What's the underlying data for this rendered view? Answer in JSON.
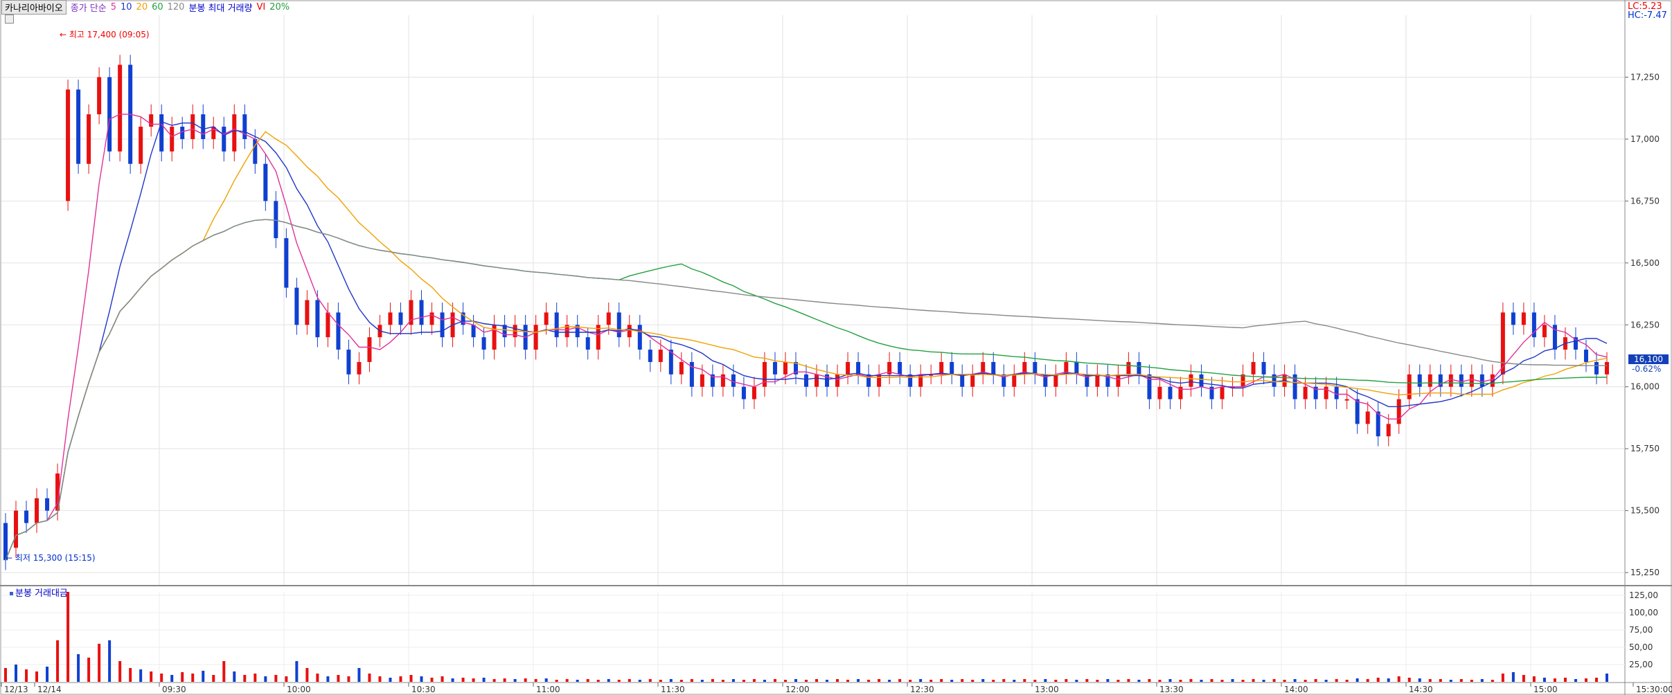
{
  "header": {
    "stock_name": "카나리아바이오",
    "ma_label": "종가 단순",
    "ma_periods": [
      "5",
      "10",
      "20",
      "60",
      "120"
    ],
    "volume_label": "분봉 최대 거래량",
    "vi_label": "VI",
    "vi_pct": "20%"
  },
  "annotations": {
    "high": "최고 17,400 (09:05)",
    "low": "최저 15,300 (15:15)"
  },
  "right": {
    "lc": "LC:5.23",
    "hc": "HC:-7.47",
    "current_price": "16,100",
    "current_change": "-0.62%"
  },
  "volume_panel": {
    "title": "분봉 거래대금"
  },
  "chart_data": [
    {
      "type": "candlestick",
      "title": "카나리아바이오",
      "y_ticks": [
        "17,250",
        "17,000",
        "16,750",
        "16,500",
        "16,250",
        "16,000",
        "15,750",
        "15,500",
        "15,250"
      ],
      "ylim": [
        15200,
        17500
      ],
      "x_ticks": [
        "12/13",
        "12/14",
        "09:30",
        "10:00",
        "10:30",
        "11:00",
        "11:30",
        "12:00",
        "12:30",
        "13:00",
        "13:30",
        "14:00",
        "14:30",
        "15:00",
        "15:30:00"
      ],
      "candles_open_close": [
        [
          15450,
          15300
        ],
        [
          15350,
          15500
        ],
        [
          15500,
          15450
        ],
        [
          15450,
          15550
        ],
        [
          15550,
          15500
        ],
        [
          15500,
          15650
        ],
        [
          16750,
          17200
        ],
        [
          17200,
          16900
        ],
        [
          16900,
          17100
        ],
        [
          17100,
          17250
        ],
        [
          17250,
          16950
        ],
        [
          16950,
          17300
        ],
        [
          17300,
          16900
        ],
        [
          16900,
          17050
        ],
        [
          17050,
          17100
        ],
        [
          17100,
          16950
        ],
        [
          16950,
          17050
        ],
        [
          17050,
          17000
        ],
        [
          17000,
          17100
        ],
        [
          17100,
          17000
        ],
        [
          17000,
          17050
        ],
        [
          17050,
          16950
        ],
        [
          16950,
          17100
        ],
        [
          17100,
          17000
        ],
        [
          17000,
          16900
        ],
        [
          16900,
          16750
        ],
        [
          16750,
          16600
        ],
        [
          16600,
          16400
        ],
        [
          16400,
          16250
        ],
        [
          16250,
          16350
        ],
        [
          16350,
          16200
        ],
        [
          16200,
          16300
        ],
        [
          16300,
          16150
        ],
        [
          16150,
          16050
        ],
        [
          16050,
          16100
        ],
        [
          16100,
          16200
        ],
        [
          16200,
          16250
        ],
        [
          16250,
          16300
        ],
        [
          16300,
          16250
        ],
        [
          16250,
          16350
        ],
        [
          16350,
          16250
        ],
        [
          16250,
          16300
        ],
        [
          16300,
          16200
        ],
        [
          16200,
          16300
        ],
        [
          16300,
          16250
        ],
        [
          16250,
          16200
        ],
        [
          16200,
          16150
        ],
        [
          16150,
          16250
        ],
        [
          16250,
          16200
        ],
        [
          16200,
          16250
        ],
        [
          16250,
          16150
        ],
        [
          16150,
          16250
        ],
        [
          16250,
          16300
        ],
        [
          16300,
          16200
        ],
        [
          16200,
          16250
        ],
        [
          16250,
          16200
        ],
        [
          16200,
          16150
        ],
        [
          16150,
          16250
        ],
        [
          16250,
          16300
        ],
        [
          16300,
          16200
        ],
        [
          16200,
          16250
        ],
        [
          16250,
          16150
        ],
        [
          16150,
          16100
        ],
        [
          16100,
          16150
        ],
        [
          16150,
          16050
        ],
        [
          16050,
          16100
        ],
        [
          16100,
          16000
        ],
        [
          16000,
          16050
        ],
        [
          16050,
          16000
        ],
        [
          16000,
          16050
        ],
        [
          16050,
          16000
        ],
        [
          16000,
          15950
        ],
        [
          15950,
          16000
        ],
        [
          16000,
          16100
        ],
        [
          16100,
          16050
        ],
        [
          16050,
          16100
        ],
        [
          16100,
          16050
        ],
        [
          16050,
          16000
        ],
        [
          16000,
          16050
        ],
        [
          16050,
          16000
        ],
        [
          16000,
          16050
        ],
        [
          16050,
          16100
        ],
        [
          16100,
          16050
        ],
        [
          16050,
          16000
        ],
        [
          16000,
          16050
        ],
        [
          16050,
          16100
        ],
        [
          16100,
          16050
        ],
        [
          16050,
          16000
        ],
        [
          16000,
          16050
        ],
        [
          16050,
          16050
        ],
        [
          16050,
          16100
        ],
        [
          16100,
          16050
        ],
        [
          16050,
          16000
        ],
        [
          16000,
          16050
        ],
        [
          16050,
          16100
        ],
        [
          16100,
          16050
        ],
        [
          16050,
          16000
        ],
        [
          16000,
          16050
        ],
        [
          16050,
          16100
        ],
        [
          16100,
          16050
        ],
        [
          16050,
          16000
        ],
        [
          16000,
          16050
        ],
        [
          16050,
          16100
        ],
        [
          16100,
          16050
        ],
        [
          16050,
          16000
        ],
        [
          16000,
          16050
        ],
        [
          16050,
          16000
        ],
        [
          16000,
          16050
        ],
        [
          16050,
          16100
        ],
        [
          16100,
          16050
        ],
        [
          16050,
          15950
        ],
        [
          15950,
          16000
        ],
        [
          16000,
          15950
        ],
        [
          15950,
          16000
        ],
        [
          16000,
          16050
        ],
        [
          16050,
          16000
        ],
        [
          16000,
          15950
        ],
        [
          15950,
          16000
        ],
        [
          16000,
          16000
        ],
        [
          16000,
          16050
        ],
        [
          16050,
          16100
        ],
        [
          16100,
          16050
        ],
        [
          16050,
          16000
        ],
        [
          16000,
          16050
        ],
        [
          16050,
          15950
        ],
        [
          15950,
          16000
        ],
        [
          16000,
          15950
        ],
        [
          15950,
          16000
        ],
        [
          16000,
          15950
        ],
        [
          15950,
          15950
        ],
        [
          15950,
          15850
        ],
        [
          15850,
          15900
        ],
        [
          15900,
          15800
        ],
        [
          15800,
          15850
        ],
        [
          15850,
          15950
        ],
        [
          15950,
          16050
        ],
        [
          16050,
          16000
        ],
        [
          16000,
          16050
        ],
        [
          16050,
          16000
        ],
        [
          16000,
          16050
        ],
        [
          16050,
          16000
        ],
        [
          16000,
          16050
        ],
        [
          16050,
          16000
        ],
        [
          16000,
          16050
        ],
        [
          16050,
          16300
        ],
        [
          16300,
          16250
        ],
        [
          16250,
          16300
        ],
        [
          16300,
          16200
        ],
        [
          16200,
          16250
        ],
        [
          16250,
          16150
        ],
        [
          16150,
          16200
        ],
        [
          16200,
          16150
        ],
        [
          16150,
          16100
        ],
        [
          16100,
          16050
        ],
        [
          16050,
          16100
        ]
      ],
      "moving_averages": [
        {
          "name": "5",
          "color": "#e0309b"
        },
        {
          "name": "10",
          "color": "#1f35c8"
        },
        {
          "name": "20",
          "color": "#f0a000"
        },
        {
          "name": "60",
          "color": "#22a040"
        },
        {
          "name": "120",
          "color": "#888888"
        }
      ]
    },
    {
      "type": "bar",
      "title": "분봉 거래대금",
      "y_ticks": [
        "125,00",
        "100,00",
        "75,00",
        "50,00",
        "25,00"
      ],
      "ylim": [
        0,
        130
      ],
      "values": [
        20,
        25,
        18,
        15,
        22,
        60,
        130,
        40,
        35,
        55,
        60,
        30,
        20,
        18,
        15,
        12,
        10,
        14,
        12,
        16,
        10,
        30,
        15,
        10,
        12,
        8,
        10,
        8,
        30,
        20,
        12,
        8,
        10,
        8,
        20,
        12,
        8,
        6,
        8,
        10,
        8,
        6,
        8,
        5,
        6,
        5,
        6,
        4,
        5,
        4,
        5,
        4,
        5,
        3,
        4,
        3,
        4,
        3,
        4,
        3,
        4,
        3,
        4,
        3,
        4,
        3,
        4,
        3,
        4,
        3,
        4,
        3,
        4,
        3,
        4,
        3,
        4,
        3,
        4,
        3,
        4,
        3,
        4,
        3,
        4,
        3,
        4,
        3,
        4,
        3,
        4,
        3,
        4,
        3,
        4,
        3,
        4,
        3,
        4,
        3,
        4,
        3,
        4,
        3,
        4,
        3,
        4,
        3,
        4,
        3,
        4,
        3,
        4,
        3,
        4,
        3,
        4,
        3,
        4,
        3,
        4,
        3,
        4,
        3,
        4,
        3,
        4,
        3,
        4,
        3,
        5,
        4,
        6,
        5,
        8,
        6,
        5,
        4,
        4,
        3,
        4,
        3,
        4,
        3,
        12,
        14,
        10,
        8,
        6,
        5,
        6,
        4,
        5,
        6,
        12
      ]
    }
  ]
}
